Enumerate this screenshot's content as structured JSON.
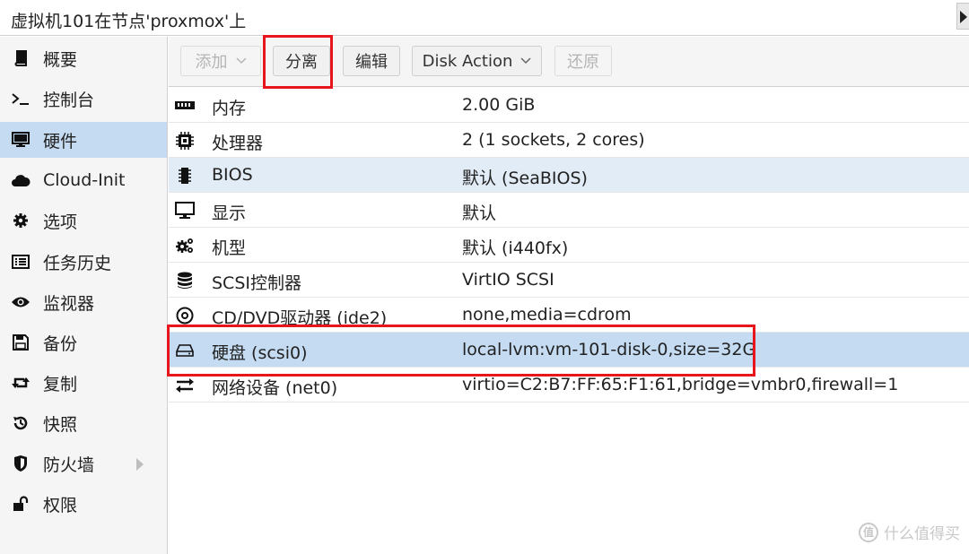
{
  "window": {
    "title": "虚拟机101在节点'proxmox'上"
  },
  "sidebar": {
    "items": [
      {
        "label": "概要",
        "icon": "book-icon",
        "selected": false
      },
      {
        "label": "控制台",
        "icon": "terminal-icon",
        "selected": false
      },
      {
        "label": "硬件",
        "icon": "monitor-icon",
        "selected": true
      },
      {
        "label": "Cloud-Init",
        "icon": "cloud-icon",
        "selected": false
      },
      {
        "label": "选项",
        "icon": "gear-icon",
        "selected": false
      },
      {
        "label": "任务历史",
        "icon": "list-icon",
        "selected": false
      },
      {
        "label": "监视器",
        "icon": "eye-icon",
        "selected": false
      },
      {
        "label": "备份",
        "icon": "floppy-icon",
        "selected": false
      },
      {
        "label": "复制",
        "icon": "retweet-icon",
        "selected": false
      },
      {
        "label": "快照",
        "icon": "history-icon",
        "selected": false
      },
      {
        "label": "防火墙",
        "icon": "shield-icon",
        "selected": false,
        "expandable": true
      },
      {
        "label": "权限",
        "icon": "unlock-icon",
        "selected": false
      }
    ]
  },
  "toolbar": {
    "add_label": "添加",
    "detach_label": "分离",
    "edit_label": "编辑",
    "disk_action_label": "Disk Action",
    "revert_label": "还原"
  },
  "hardware": {
    "rows": [
      {
        "icon": "memory-icon",
        "name": "内存",
        "value": "2.00 GiB"
      },
      {
        "icon": "cpu-icon",
        "name": "处理器",
        "value": "2 (1 sockets, 2 cores)"
      },
      {
        "icon": "chip-icon",
        "name": "BIOS",
        "value": "默认 (SeaBIOS)"
      },
      {
        "icon": "desktop-icon",
        "name": "显示",
        "value": "默认"
      },
      {
        "icon": "cogs-icon",
        "name": "机型",
        "value": "默认 (i440fx)"
      },
      {
        "icon": "database-icon",
        "name": "SCSI控制器",
        "value": "VirtIO SCSI"
      },
      {
        "icon": "cdrom-icon",
        "name": "CD/DVD驱动器 (ide2)",
        "value": "none,media=cdrom"
      },
      {
        "icon": "hdd-icon",
        "name": "硬盘 (scsi0)",
        "value": "local-lvm:vm-101-disk-0,size=32G"
      },
      {
        "icon": "exchange-icon",
        "name": "网络设备 (net0)",
        "value": "virtio=C2:B7:FF:65:F1:61,bridge=vmbr0,firewall=1"
      }
    ]
  },
  "watermark": {
    "badge": "值",
    "text": "什么值得买"
  },
  "colors": {
    "selected": "#c4dbf1",
    "alt_row": "#e2ecf6",
    "highlight": "#e8161c"
  }
}
